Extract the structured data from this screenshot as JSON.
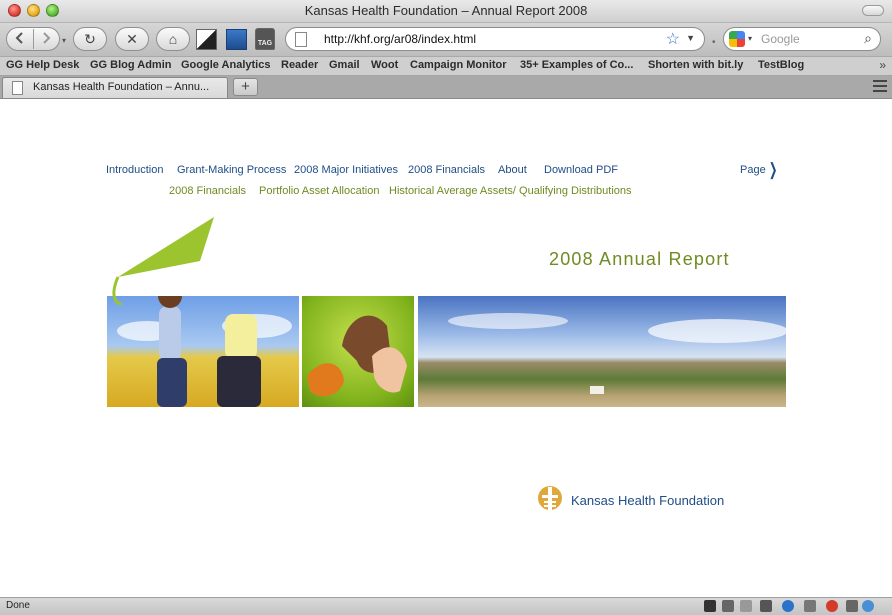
{
  "window": {
    "title": "Kansas Health Foundation – Annual Report 2008"
  },
  "toolbar": {
    "back_icon": "back-arrow-icon",
    "forward_icon": "forward-arrow-icon",
    "reload_glyph": "↻",
    "stop_glyph": "✕",
    "home_glyph": "⌂",
    "url": "http://khf.org/ar08/index.html",
    "search_placeholder": "Google"
  },
  "bookmarks": [
    "GG Help Desk",
    "GG Blog Admin",
    "Google Analytics",
    "Reader",
    "Gmail",
    "Woot",
    "Campaign Monitor",
    "35+ Examples of Co...",
    "Shorten with bit.ly",
    "TestBlog"
  ],
  "tab": {
    "title": "Kansas Health Foundation – Annu..."
  },
  "page": {
    "nav_primary": [
      "Introduction",
      "Grant-Making Process",
      "2008 Major Initiatives",
      "2008 Financials",
      "About",
      "Download PDF"
    ],
    "page_link": "Page",
    "nav_secondary": [
      "2008 Financials",
      "Portfolio Asset Allocation",
      "Historical Average Assets/ Qualifying Distributions"
    ],
    "report_title": "2008 Annual Report",
    "foundation_name": "Kansas Health Foundation",
    "colors": {
      "nav_blue": "#1f4d87",
      "accent_green": "#6f8b22"
    }
  },
  "status": {
    "text": "Done"
  }
}
